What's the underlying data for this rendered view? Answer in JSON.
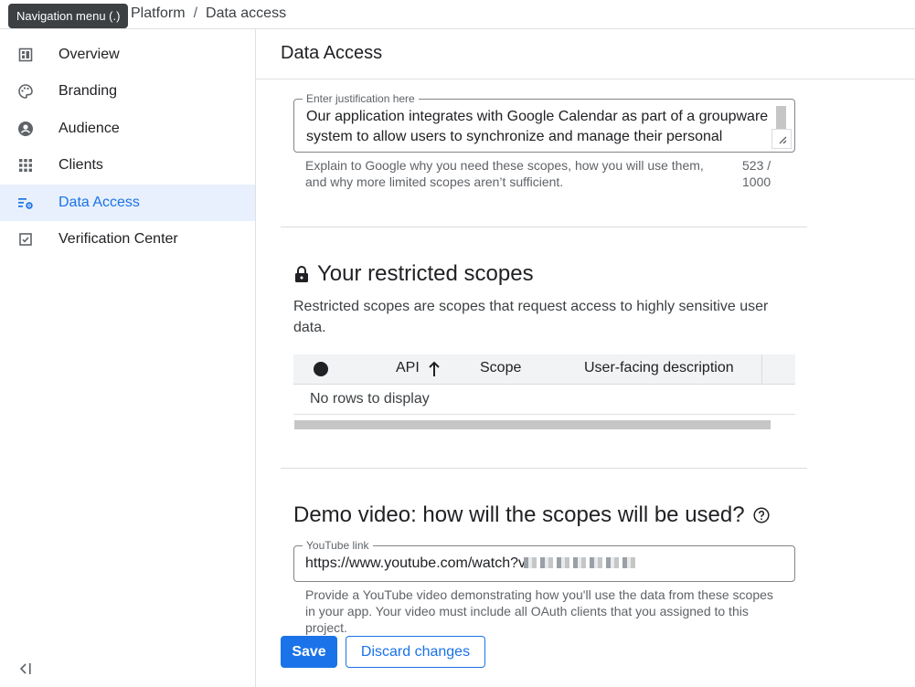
{
  "tooltip": "Navigation menu (.)",
  "breadcrumb": {
    "parent": "Platform",
    "separator": "/",
    "current": "Data access"
  },
  "sidebar": {
    "items": [
      {
        "label": "Overview",
        "icon": "dashboard-icon"
      },
      {
        "label": "Branding",
        "icon": "palette-icon"
      },
      {
        "label": "Audience",
        "icon": "person-icon"
      },
      {
        "label": "Clients",
        "icon": "grid-icon"
      },
      {
        "label": "Data Access",
        "icon": "data-settings-icon",
        "active": true
      },
      {
        "label": "Verification Center",
        "icon": "checkbox-icon"
      }
    ],
    "collapse_icon": "collapse-sidebar-icon"
  },
  "main": {
    "title": "Data Access",
    "justification": {
      "label": "Enter justification here",
      "value": "Our application integrates with Google Calendar as part of a groupware system to allow users to synchronize and manage their personal",
      "hint": "Explain to Google why you need these scopes, how you will use them, and why more limited scopes aren’t sufficient.",
      "count": "523 / 1000"
    },
    "restricted": {
      "title": "Your restricted scopes",
      "description": "Restricted scopes are scopes that request access to highly sensitive user data.",
      "columns": [
        "API",
        "Scope",
        "User-facing description"
      ],
      "empty": "No rows to display"
    },
    "demo": {
      "title": "Demo video: how will the scopes will be used?",
      "label": "YouTube link",
      "value": "https://www.youtube.com/watch?v",
      "hint": "Provide a YouTube video demonstrating how you'll use the data from these scopes in your app. Your video must include all OAuth clients that you assigned to this project."
    },
    "buttons": {
      "save": "Save",
      "discard": "Discard changes"
    }
  },
  "colors": {
    "accent": "#1a73e8",
    "active_bg": "#e8f0fe"
  }
}
